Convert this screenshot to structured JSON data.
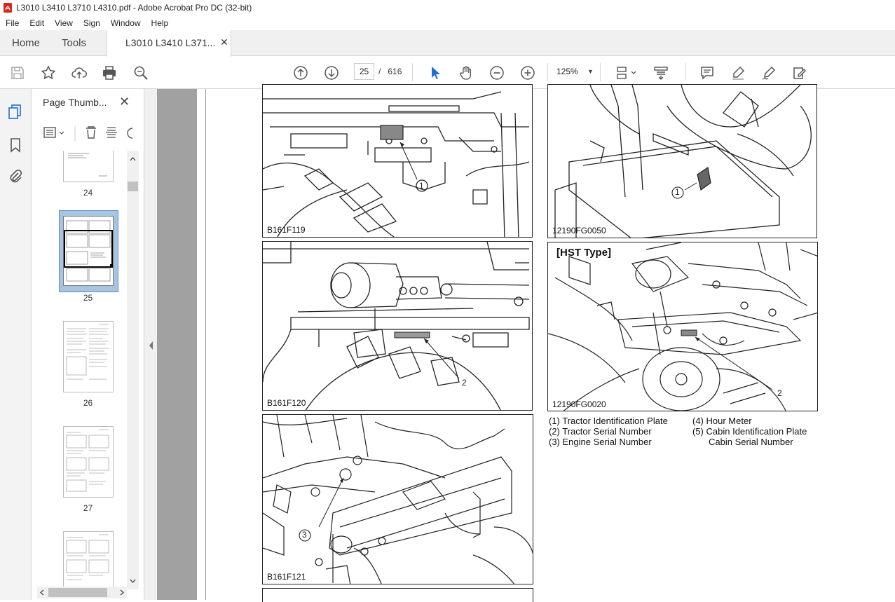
{
  "window": {
    "title": "L3010 L3410 L3710 L4310.pdf - Adobe Acrobat Pro DC (32-bit)"
  },
  "menu": [
    "File",
    "Edit",
    "View",
    "Sign",
    "Window",
    "Help"
  ],
  "tabs": {
    "home": "Home",
    "tools": "Tools",
    "document": "L3010 L3410 L371...",
    "close_glyph": "✕"
  },
  "toolbar": {
    "page_current": "25",
    "page_separator": "/",
    "page_total": "616",
    "zoom": "125%",
    "icons": [
      "save-icon",
      "star-icon",
      "upload-icon",
      "print-icon",
      "zoom-search-icon",
      "page-up-icon",
      "page-down-icon",
      "select-cursor-icon",
      "hand-icon",
      "zoom-out-icon",
      "zoom-in-icon",
      "fit-page-icon",
      "scroll-mode-icon",
      "comment-icon",
      "highlight-icon",
      "sign-pen-icon",
      "edit-pdf-icon"
    ]
  },
  "sidebar": {
    "title": "Page Thumb...",
    "close_glyph": "✕",
    "thumbnails": [
      {
        "label": "24"
      },
      {
        "label": "25",
        "selected": true
      },
      {
        "label": "26"
      },
      {
        "label": "27"
      },
      {
        "label": ""
      }
    ]
  },
  "document": {
    "figures": [
      {
        "caption": "B161F119",
        "callout": "1"
      },
      {
        "caption": "12190FG0050",
        "callout": "1"
      },
      {
        "caption": "B161F120",
        "callout": "2"
      },
      {
        "caption": "12190FG0020",
        "callout": "2",
        "heading": "[HST Type]"
      },
      {
        "caption": "B161F121",
        "callout": "3"
      }
    ],
    "legend": {
      "left": [
        "(1)  Tractor Identification Plate",
        "(2)  Tractor Serial Number",
        "(3)  Engine Serial Number"
      ],
      "right": [
        "(4)  Hour Meter",
        "(5)  Cabin Identification Plate",
        "Cabin Serial Number"
      ]
    }
  },
  "colors": {
    "acrobat_red": "#d7281e",
    "selection_blue": "#1f6fd0",
    "thumb_selected_bg": "#a9c4e0"
  }
}
